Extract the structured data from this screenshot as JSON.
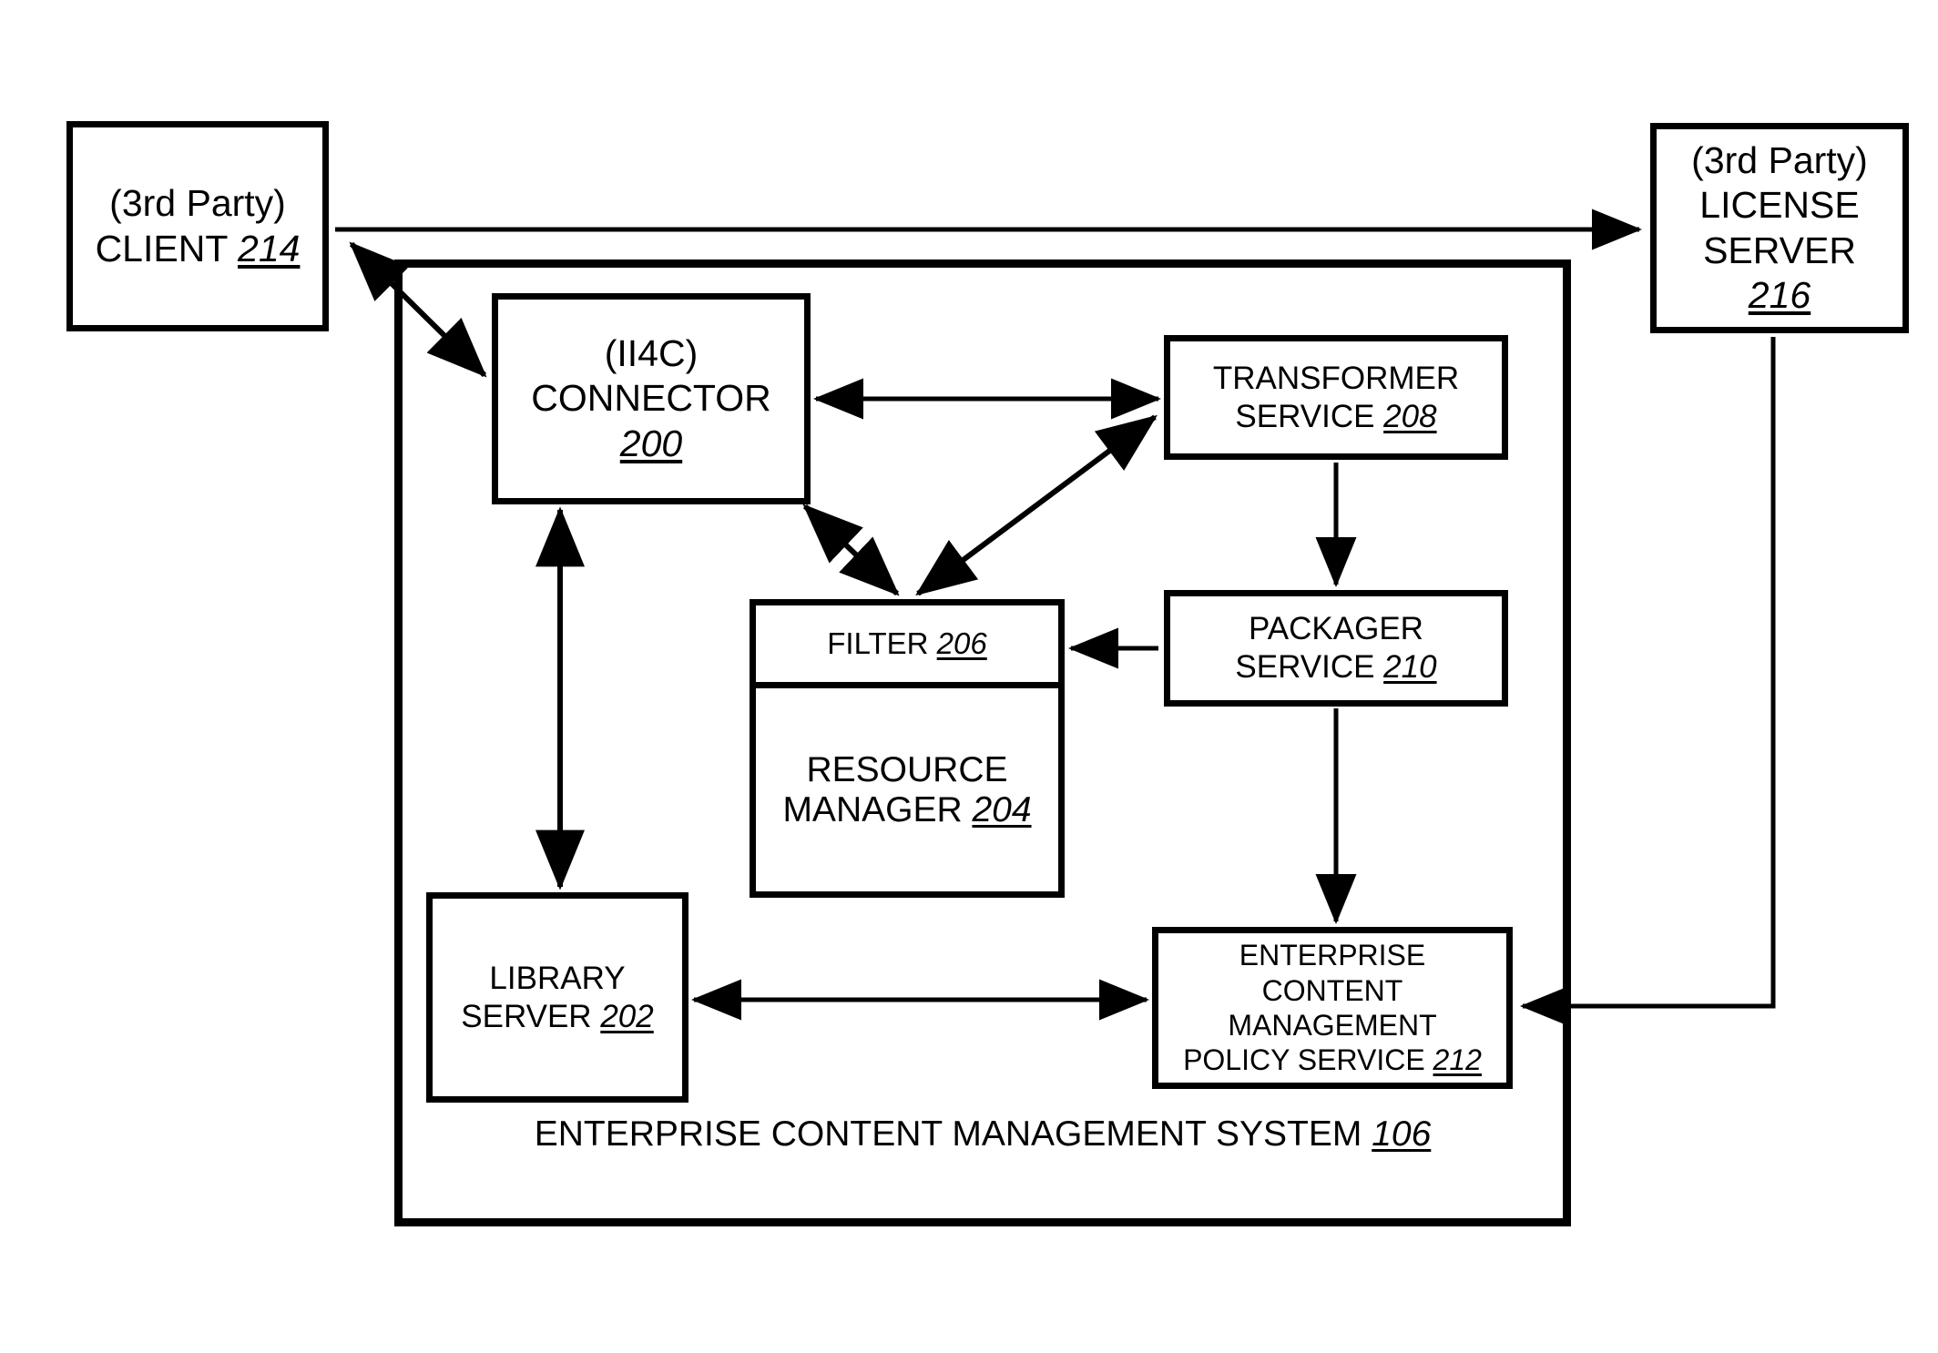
{
  "diagram": {
    "title": "Enterprise Content Management System architecture block diagram",
    "system_label": {
      "line1": "ENTERPRISE CONTENT",
      "line2": "MANAGEMENT SYSTEM ",
      "ref": "106"
    },
    "nodes": {
      "client": {
        "line1": "(3rd Party)",
        "line2": "CLIENT ",
        "ref": "214"
      },
      "license_server": {
        "line1": "(3rd Party)",
        "line2": "LICENSE",
        "line3": "SERVER",
        "ref": "216"
      },
      "connector": {
        "line1": "(II4C)",
        "line2": "CONNECTOR",
        "ref": "200"
      },
      "transformer_service": {
        "line1": "TRANSFORMER",
        "line2": "SERVICE ",
        "ref": "208"
      },
      "packager_service": {
        "line1": "PACKAGER",
        "line2": "SERVICE ",
        "ref": "210"
      },
      "filter": {
        "line1": "FILTER ",
        "ref": "206"
      },
      "resource_manager": {
        "line1": "RESOURCE",
        "line2": "MANAGER ",
        "ref": "204"
      },
      "library_server": {
        "line1": "LIBRARY",
        "line2": "SERVER ",
        "ref": "202"
      },
      "policy_service": {
        "line1": "ENTERPRISE",
        "line2": "CONTENT",
        "line3": "MANAGEMENT",
        "line4": "POLICY SERVICE ",
        "ref": "212"
      }
    },
    "colors": {
      "stroke": "#000000",
      "background": "#ffffff"
    }
  }
}
